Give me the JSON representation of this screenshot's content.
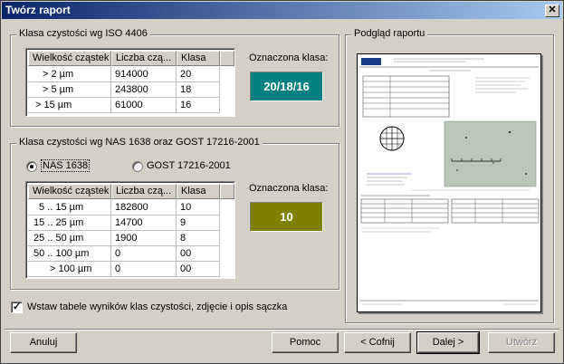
{
  "window": {
    "title": "Twórz raport",
    "close_glyph": "✕"
  },
  "iso": {
    "group_title": "Klasa czystości wg ISO 4406",
    "columns": [
      "Wielkość cząstek",
      "Liczba czą...",
      "Klasa"
    ],
    "rows": [
      [
        "> 2 µm",
        "914000",
        "20"
      ],
      [
        "> 5 µm",
        "243800",
        "18"
      ],
      [
        "> 15 µm",
        "61000",
        "16"
      ]
    ],
    "result_label": "Oznaczona klasa:",
    "result_value": "20/18/16",
    "result_color": "#008080"
  },
  "nas": {
    "group_title": "Klasa czystości wg NAS 1638 oraz GOST 17216-2001",
    "radio_nas": "NAS 1638",
    "radio_gost": "GOST 17216-2001",
    "selected": "NAS 1638",
    "columns": [
      "Wielkość cząstek",
      "Liczba czą...",
      "Klasa"
    ],
    "rows": [
      [
        "5 .. 15 µm",
        "182800",
        "10"
      ],
      [
        "15 .. 25 µm",
        "14700",
        "9"
      ],
      [
        "25 .. 50 µm",
        "1900",
        "8"
      ],
      [
        "50 .. 100 µm",
        "0",
        "00"
      ],
      [
        "> 100 µm",
        "0",
        "00"
      ]
    ],
    "result_label": "Oznaczona klasa:",
    "result_value": "10",
    "result_color": "#808000"
  },
  "checkbox": {
    "label": "Wstaw tabele wyników klas czystości, zdjęcie i opis sączka",
    "checked": true,
    "glyph": "✓"
  },
  "preview": {
    "group_title": "Podgląd raportu",
    "logo": "6bT"
  },
  "buttons": {
    "cancel": "Anuluj",
    "help": "Pomoc",
    "back": "<  Cofnij",
    "next": "Dalej  >",
    "create": "Utwórz"
  }
}
